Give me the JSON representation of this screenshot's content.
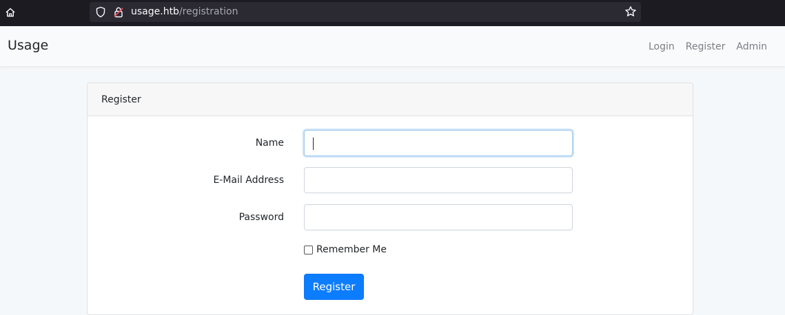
{
  "browser": {
    "url_host": "usage.htb",
    "url_path": "/registration"
  },
  "navbar": {
    "brand": "Usage",
    "links": [
      "Login",
      "Register",
      "Admin"
    ]
  },
  "card": {
    "header": "Register",
    "fields": {
      "name_label": "Name",
      "name_value": "",
      "email_label": "E-Mail Address",
      "email_value": "",
      "password_label": "Password",
      "password_value": ""
    },
    "remember_label": "Remember Me",
    "remember_checked": false,
    "submit_label": "Register"
  },
  "colors": {
    "primary": "#0d7dff",
    "browser_chrome": "#1c1b22",
    "page_background": "#f5f8fa"
  }
}
